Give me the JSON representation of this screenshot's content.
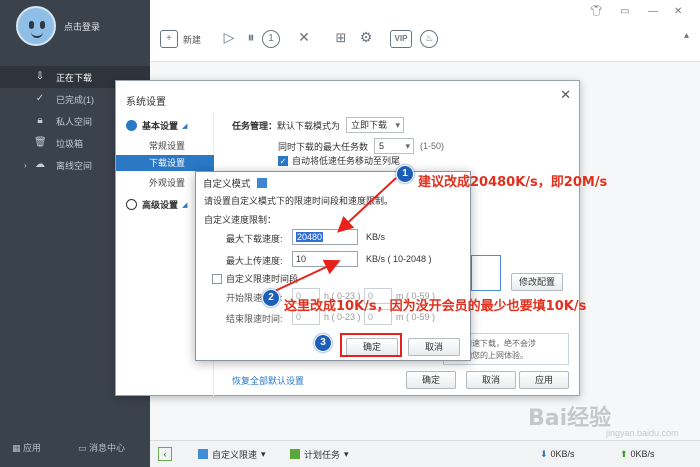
{
  "sidebar": {
    "login": "点击登录",
    "items": [
      {
        "label": "正在下载",
        "icon": "download-icon",
        "active": true
      },
      {
        "label": "已完成(1)",
        "icon": "check-circle-icon"
      },
      {
        "label": "私人空间",
        "icon": "lock-icon"
      },
      {
        "label": "垃圾箱",
        "icon": "trash-icon"
      },
      {
        "label": "离线空间",
        "icon": "cloud-icon"
      }
    ],
    "bottom": {
      "apps": "应用",
      "messages": "消息中心"
    }
  },
  "toolbar": {
    "new_label": "新建",
    "vip": "VIP"
  },
  "statusbar": {
    "custom_speed": "自定义限速",
    "schedule": "计划任务",
    "down_speed": "0KB/s",
    "up_speed": "0KB/s"
  },
  "settings": {
    "title": "系统设置",
    "nav": {
      "basic": "基本设置",
      "general": "常规设置",
      "download": "下载设置",
      "appearance": "外观设置",
      "advanced": "高级设置"
    },
    "task_mgmt_label": "任务管理：",
    "default_mode_label": "默认下载模式为",
    "default_mode_value": "立即下载",
    "max_tasks_label": "同时下载的最大任务数",
    "max_tasks_value": "5",
    "max_tasks_range": "(1-50)",
    "auto_move_label": "自动将低速任务移动至列尾",
    "modify_config": "修改配置",
    "restore_defaults": "恢复全部默认设置",
    "ok": "确定",
    "cancel": "取消",
    "apply": "应用",
    "note_line1": "好友加速下载，绝不会涉",
    "note_line2": "会影响您的上网体验。"
  },
  "custom_dialog": {
    "title": "自定义模式",
    "desc": "请设置自定义模式下的限速时间段和速度限制。",
    "speed_limit_label": "自定义速度限制：",
    "max_down_label": "最大下载速度:",
    "max_down_value": "20480",
    "max_down_unit": "KB/s",
    "max_up_label": "最大上传速度:",
    "max_up_value": "10",
    "max_up_unit": "KB/s ( 10-2048 )",
    "time_period_label": "自定义限速时间段",
    "start_label": "开始限速时间:",
    "end_label": "结束限速时间:",
    "start_h": "0",
    "start_m": "0",
    "end_h": "0",
    "end_m": "0",
    "hour_unit": "h ( 0-23 )",
    "min_unit": "m ( 0-59 )",
    "ok": "确定",
    "cancel": "取消"
  },
  "annotations": {
    "n1": "1",
    "n2": "2",
    "n3": "3",
    "text1": "建议改成20480K/s，即20M/s",
    "text2": "这里改成10K/s，因为没开会员的最少也要填10K/s"
  },
  "watermark": {
    "brand": "Bai经验",
    "url": "jingyan.baidu.com"
  },
  "colors": {
    "sidebar": "#3a424c",
    "accent": "#2b78c5",
    "annotation_red": "#e0301e",
    "annotation_blue": "#1c5fb8"
  }
}
